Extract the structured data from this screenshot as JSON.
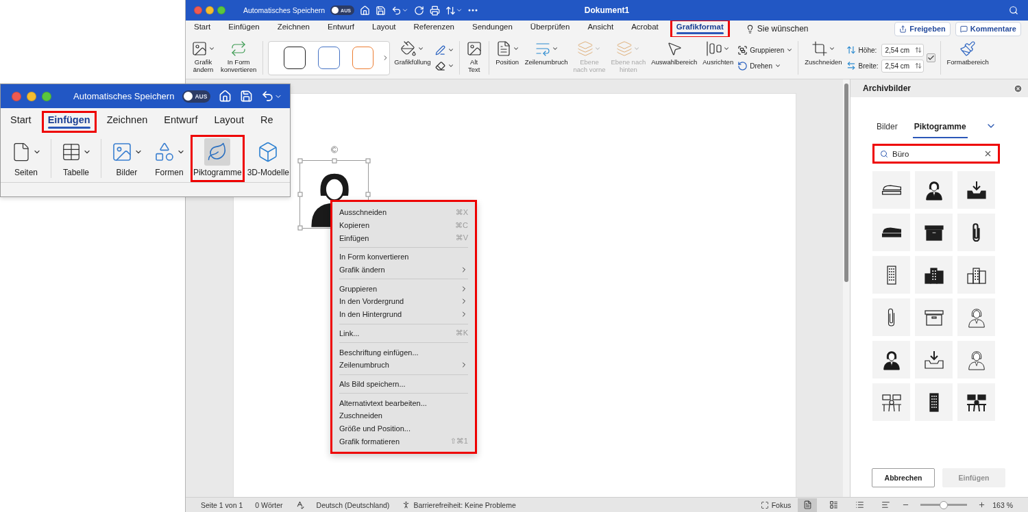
{
  "main_window": {
    "autosave_label": "Automatisches Speichern",
    "autosave_toggle": {
      "label": "AUS",
      "on": false
    },
    "title": "Dokument1",
    "tabs": [
      {
        "label": "Start",
        "selected": false,
        "highlighted": false
      },
      {
        "label": "Einfügen",
        "selected": false,
        "highlighted": false
      },
      {
        "label": "Zeichnen",
        "selected": false,
        "highlighted": false
      },
      {
        "label": "Entwurf",
        "selected": false,
        "highlighted": false
      },
      {
        "label": "Layout",
        "selected": false,
        "highlighted": false
      },
      {
        "label": "Referenzen",
        "selected": false,
        "highlighted": false
      },
      {
        "label": "Sendungen",
        "selected": false,
        "highlighted": false
      },
      {
        "label": "Überprüfen",
        "selected": false,
        "highlighted": false
      },
      {
        "label": "Ansicht",
        "selected": false,
        "highlighted": false
      },
      {
        "label": "Acrobat",
        "selected": false,
        "highlighted": false
      },
      {
        "label": "Grafikformat",
        "selected": true,
        "highlighted": true
      }
    ],
    "tell_me": "Sie wünschen",
    "share_button": "Freigeben",
    "comments_button": "Kommentare",
    "ribbon": {
      "change_graphic": "Grafik\nändern",
      "convert_to_shape": "In Form\nkonvertieren",
      "styles": [
        {
          "color": "#1f1f1f"
        },
        {
          "color": "#4472c4"
        },
        {
          "color": "#ed7d31"
        }
      ],
      "graphic_fill": "Grafikfüllung",
      "alt_text": "Alt\nText",
      "position": "Position",
      "wrap_text": "Zeilenumbruch",
      "arrange": [
        {
          "label": "Ebene\nnach vorne",
          "disabled": true
        },
        {
          "label": "Ebene nach\nhinten",
          "disabled": true
        },
        {
          "label": "Auswahlbereich",
          "disabled": false
        },
        {
          "label": "Ausrichten",
          "disabled": false
        }
      ],
      "group": "Gruppieren",
      "rotate": "Drehen",
      "crop": "Zuschneiden",
      "height": {
        "label": "Höhe:",
        "value": "2,54 cm"
      },
      "width": {
        "label": "Breite:",
        "value": "2,54 cm"
      },
      "lock_aspect": {
        "checked": true
      },
      "format_pane": "Formatbereich"
    }
  },
  "inset_window": {
    "autosave_label": "Automatisches Speichern",
    "autosave_toggle": {
      "label": "AUS",
      "on": false
    },
    "tabs": [
      {
        "label": "Start",
        "selected": false,
        "highlighted": false
      },
      {
        "label": "Einfügen",
        "selected": true,
        "highlighted": true
      },
      {
        "label": "Zeichnen",
        "selected": false,
        "highlighted": false
      },
      {
        "label": "Entwurf",
        "selected": false,
        "highlighted": false
      },
      {
        "label": "Layout",
        "selected": false,
        "highlighted": false
      },
      {
        "label": "Re",
        "selected": false,
        "highlighted": false
      }
    ],
    "ribbon": [
      {
        "label": "Seiten",
        "dropdown": true,
        "pressed": false,
        "highlighted": false
      },
      {
        "label": "Tabelle",
        "dropdown": true,
        "pressed": false,
        "highlighted": false
      },
      {
        "label": "Bilder",
        "dropdown": true,
        "pressed": false,
        "highlighted": false
      },
      {
        "label": "Formen",
        "dropdown": true,
        "pressed": false,
        "highlighted": false
      },
      {
        "label": "Piktogramme",
        "dropdown": false,
        "pressed": true,
        "highlighted": true
      },
      {
        "label": "3D-Modelle",
        "dropdown": false,
        "pressed": false,
        "highlighted": false
      }
    ]
  },
  "document": {
    "image": {
      "selected": true
    }
  },
  "context_menu": {
    "highlighted": true,
    "groups": [
      {
        "items": [
          {
            "label": "Ausschneiden",
            "shortcut": "⌘X",
            "submenu": false
          },
          {
            "label": "Kopieren",
            "shortcut": "⌘C",
            "submenu": false
          },
          {
            "label": "Einfügen",
            "shortcut": "⌘V",
            "submenu": false
          }
        ]
      },
      {
        "items": [
          {
            "label": "In Form konvertieren",
            "submenu": false
          },
          {
            "label": "Grafik ändern",
            "submenu": true
          }
        ]
      },
      {
        "items": [
          {
            "label": "Gruppieren",
            "submenu": true
          },
          {
            "label": "In den Vordergrund",
            "submenu": true
          },
          {
            "label": "In den Hintergrund",
            "submenu": true
          }
        ]
      },
      {
        "items": [
          {
            "label": "Link...",
            "shortcut": "⌘K",
            "submenu": false
          }
        ]
      },
      {
        "items": [
          {
            "label": "Beschriftung einfügen...",
            "submenu": false
          },
          {
            "label": "Zeilenumbruch",
            "submenu": true
          }
        ]
      },
      {
        "items": [
          {
            "label": "Als Bild speichern...",
            "submenu": false
          }
        ]
      },
      {
        "items": [
          {
            "label": "Alternativtext bearbeiten...",
            "submenu": false
          },
          {
            "label": "Zuschneiden",
            "submenu": false
          },
          {
            "label": "Größe und Position...",
            "submenu": false
          },
          {
            "label": "Grafik formatieren",
            "shortcut": "⇧⌘1",
            "submenu": false
          }
        ]
      }
    ]
  },
  "side_pane": {
    "title": "Archivbilder",
    "tabs": [
      {
        "label": "Bilder",
        "selected": false
      },
      {
        "label": "Piktogramme",
        "selected": true
      }
    ],
    "search": {
      "value": "Büro",
      "highlighted": true
    },
    "pictograms": [
      {
        "kind": "stapler",
        "filled": false
      },
      {
        "kind": "person",
        "filled": true
      },
      {
        "kind": "inbox",
        "filled": true
      },
      {
        "kind": "stapler",
        "filled": true
      },
      {
        "kind": "box",
        "filled": true
      },
      {
        "kind": "paperclip",
        "filled": true
      },
      {
        "kind": "building",
        "filled": false
      },
      {
        "kind": "city",
        "filled": true
      },
      {
        "kind": "city",
        "filled": false
      },
      {
        "kind": "paperclip",
        "filled": false
      },
      {
        "kind": "box",
        "filled": false
      },
      {
        "kind": "person",
        "filled": false
      },
      {
        "kind": "person",
        "filled": true
      },
      {
        "kind": "inbox",
        "filled": false
      },
      {
        "kind": "person",
        "filled": false
      },
      {
        "kind": "desks",
        "filled": false
      },
      {
        "kind": "building",
        "filled": true
      },
      {
        "kind": "desks",
        "filled": true
      }
    ],
    "cancel_button": {
      "label": "Abbrechen",
      "disabled": false
    },
    "insert_button": {
      "label": "Einfügen",
      "disabled": true
    }
  },
  "status_bar": {
    "page": "Seite 1 von 1",
    "words": "0 Wörter",
    "language": "Deutsch (Deutschland)",
    "accessibility": "Barrierefreiheit: Keine Probleme",
    "focus": "Fokus",
    "views": [
      {
        "selected": true
      },
      {
        "selected": false
      },
      {
        "selected": false
      },
      {
        "selected": false
      }
    ],
    "zoom": {
      "level": 0.5,
      "reading": "163 %"
    }
  }
}
